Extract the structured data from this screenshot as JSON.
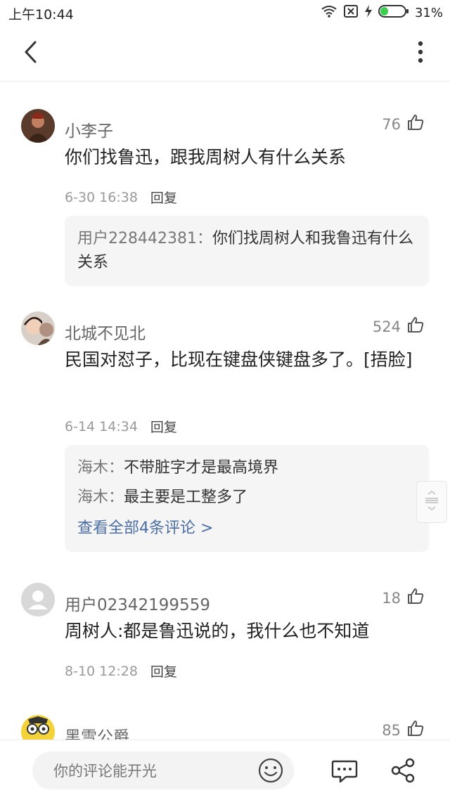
{
  "status_bar": {
    "time": "上午10:44",
    "battery_percent": "31%",
    "battery_level": 0.31,
    "icons": [
      "wifi-icon",
      "sim-off-icon",
      "charging-icon",
      "battery-icon"
    ]
  },
  "nav": {
    "back_icon": "chevron-left-icon",
    "more_icon": "more-vertical-icon"
  },
  "comments": [
    {
      "user": "小李子",
      "likes": "76",
      "text": "你们找鲁迅，跟我周树人有什么关系",
      "time": "6-30 16:38",
      "reply_label": "回复",
      "replies": [
        {
          "user": "用户228442381",
          "sep": "：",
          "text": "你们找周树人和我鲁迅有什么关系"
        }
      ]
    },
    {
      "user": "北城不见北",
      "likes": "524",
      "text": "民国对怼子，比现在键盘侠键盘多了。[捂脸]",
      "time": "6-14 14:34",
      "reply_label": "回复",
      "replies": [
        {
          "user": "海木",
          "sep": "：",
          "text": "不带脏字才是最高境界"
        },
        {
          "user": "海木",
          "sep": "：",
          "text": "最主要是工整多了"
        }
      ],
      "view_all": "查看全部4条评论 >"
    },
    {
      "user": "用户02342199559",
      "likes": "18",
      "text": "周树人:都是鲁迅说的，我什么也不知道",
      "time": "8-10 12:28",
      "reply_label": "回复"
    },
    {
      "user": "黑雪公爵",
      "likes": "85"
    }
  ],
  "bottom_bar": {
    "input_placeholder": "你的评论能开光",
    "emoji_icon": "emoji-icon",
    "comment_icon": "comment-icon",
    "share_icon": "share-icon"
  },
  "colors": {
    "link": "#4d6ea3",
    "battery_green": "#3ccf4e",
    "reply_bg": "#f5f5f5"
  }
}
